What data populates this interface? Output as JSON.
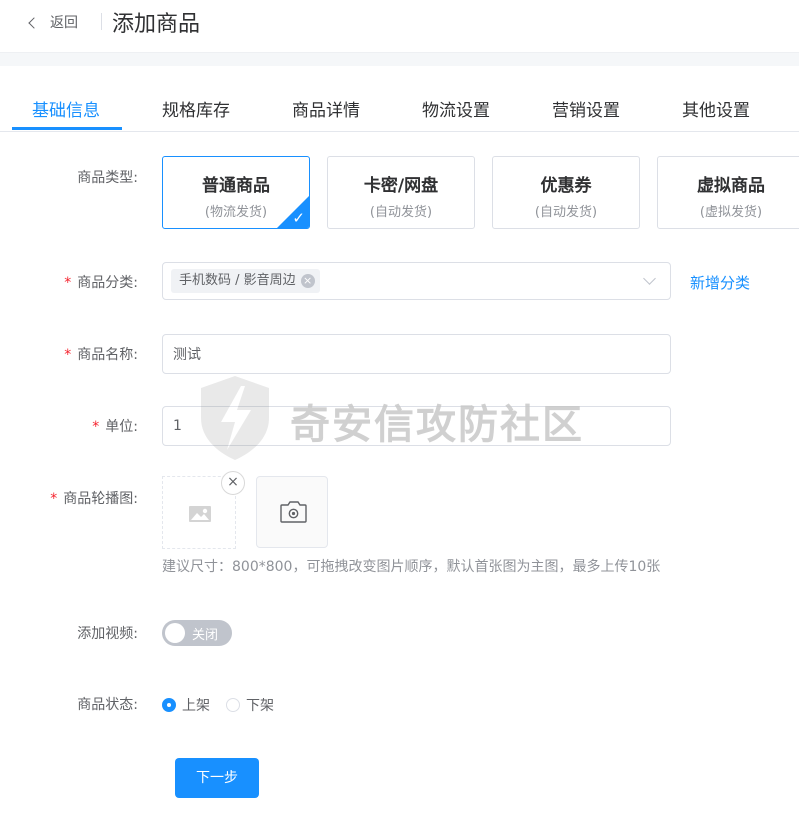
{
  "header": {
    "back_label": "返回",
    "title": "添加商品"
  },
  "tabs": [
    {
      "label": "基础信息",
      "active": true
    },
    {
      "label": "规格库存"
    },
    {
      "label": "商品详情"
    },
    {
      "label": "物流设置"
    },
    {
      "label": "营销设置"
    },
    {
      "label": "其他设置"
    }
  ],
  "form": {
    "type_label": "商品类型:",
    "types": [
      {
        "title": "普通商品",
        "sub": "(物流发货)",
        "selected": true
      },
      {
        "title": "卡密/网盘",
        "sub": "(自动发货)"
      },
      {
        "title": "优惠券",
        "sub": "(自动发货)"
      },
      {
        "title": "虚拟商品",
        "sub": "(虚拟发货)"
      }
    ],
    "category_label": "商品分类:",
    "category_tag": "手机数码 / 影音周边",
    "add_category": "新增分类",
    "name_label": "商品名称:",
    "name_value": "测试",
    "unit_label": "单位:",
    "unit_value": "1",
    "carousel_label": "商品轮播图:",
    "carousel_hint": "建议尺寸：800*800，可拖拽改变图片顺序，默认首张图为主图，最多上传10张",
    "video_label": "添加视频:",
    "video_switch": "关闭",
    "status_label": "商品状态:",
    "status_options": [
      "上架",
      "下架"
    ],
    "status_selected": "上架",
    "next_button": "下一步"
  },
  "watermark": "奇安信攻防社区",
  "colors": {
    "primary": "#1890ff",
    "required": "#f5222d"
  }
}
